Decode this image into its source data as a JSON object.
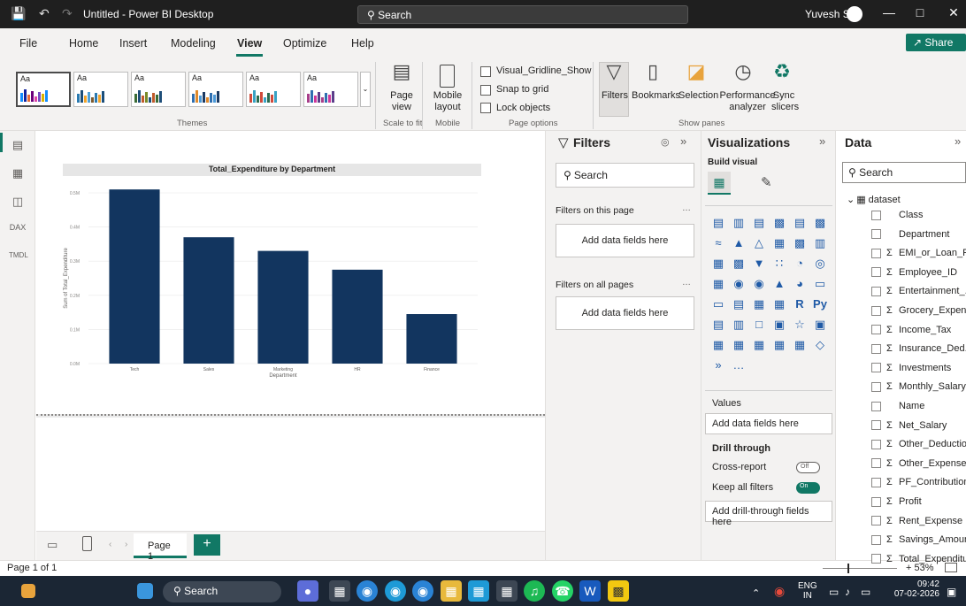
{
  "titlebar": {
    "title": "Untitled - Power BI Desktop",
    "search_placeholder": "Search",
    "user": "Yuvesh S"
  },
  "menu": {
    "items": [
      "File",
      "Home",
      "Insert",
      "Modeling",
      "View",
      "Optimize",
      "Help"
    ],
    "active": "View",
    "share": "Share"
  },
  "ribbon": {
    "themes_label": "Themes",
    "theme_preview_text": "Aa",
    "page_view": "Page view",
    "scale_to_fit": "Scale to fit",
    "mobile_layout": "Mobile layout",
    "mobile_group": "Mobile",
    "checkboxes": [
      "Visual_Gridline_Show",
      "Snap to grid",
      "Lock objects"
    ],
    "page_options": "Page options",
    "filters": "Filters",
    "bookmarks": "Bookmarks",
    "selection": "Selection",
    "performance": "Performance analyzer",
    "sync": "Sync slicers",
    "show_panes": "Show panes"
  },
  "chart_data": {
    "type": "bar",
    "title": "Total_Expenditure by Department",
    "xlabel": "Department",
    "ylabel": "Sum of Total_Expenditure",
    "categories": [
      "Tech",
      "Sales",
      "Marketing",
      "HR",
      "Finance"
    ],
    "values": [
      0.51,
      0.37,
      0.33,
      0.275,
      0.145
    ],
    "yticks": [
      "0.0M",
      "0.1M",
      "0.2M",
      "0.3M",
      "0.4M",
      "0.5M"
    ],
    "ylim": [
      0,
      0.5
    ],
    "color": "#12355f"
  },
  "pages": {
    "tab": "Page 1",
    "status": "Page 1 of 1",
    "zoom": "53%"
  },
  "filters": {
    "title": "Filters",
    "search": "Search",
    "on_this_page": "Filters on this page",
    "on_all_pages": "Filters on all pages",
    "add_fields": "Add data fields here"
  },
  "viz": {
    "title": "Visualizations",
    "build_visual": "Build visual",
    "values_label": "Values",
    "add_fields": "Add data fields here",
    "drill_through": "Drill through",
    "cross_report": "Cross-report",
    "cross_report_state": "Off",
    "keep_all_filters": "Keep all filters",
    "keep_state": "On",
    "add_drill": "Add drill-through fields here"
  },
  "data": {
    "title": "Data",
    "search": "Search",
    "dataset": "dataset",
    "fields": [
      {
        "name": "Class",
        "sigma": false
      },
      {
        "name": "Department",
        "sigma": false
      },
      {
        "name": "EMI_or_Loan_Pa...",
        "sigma": true
      },
      {
        "name": "Employee_ID",
        "sigma": true
      },
      {
        "name": "Entertainment_...",
        "sigma": true
      },
      {
        "name": "Grocery_Expense",
        "sigma": true
      },
      {
        "name": "Income_Tax",
        "sigma": true
      },
      {
        "name": "Insurance_Ded...",
        "sigma": true
      },
      {
        "name": "Investments",
        "sigma": true
      },
      {
        "name": "Monthly_Salary",
        "sigma": true
      },
      {
        "name": "Name",
        "sigma": false
      },
      {
        "name": "Net_Salary",
        "sigma": true
      },
      {
        "name": "Other_Deductio...",
        "sigma": true
      },
      {
        "name": "Other_Expenses",
        "sigma": true
      },
      {
        "name": "PF_Contribution",
        "sigma": true
      },
      {
        "name": "Profit",
        "sigma": true
      },
      {
        "name": "Rent_Expense",
        "sigma": true
      },
      {
        "name": "Savings_Amount",
        "sigma": true
      },
      {
        "name": "Total_Expenditu...",
        "sigma": true
      }
    ]
  },
  "taskbar": {
    "search": "Search",
    "lang": "ENG",
    "region": "IN",
    "time": "09:42",
    "date": "07-02-2026"
  }
}
